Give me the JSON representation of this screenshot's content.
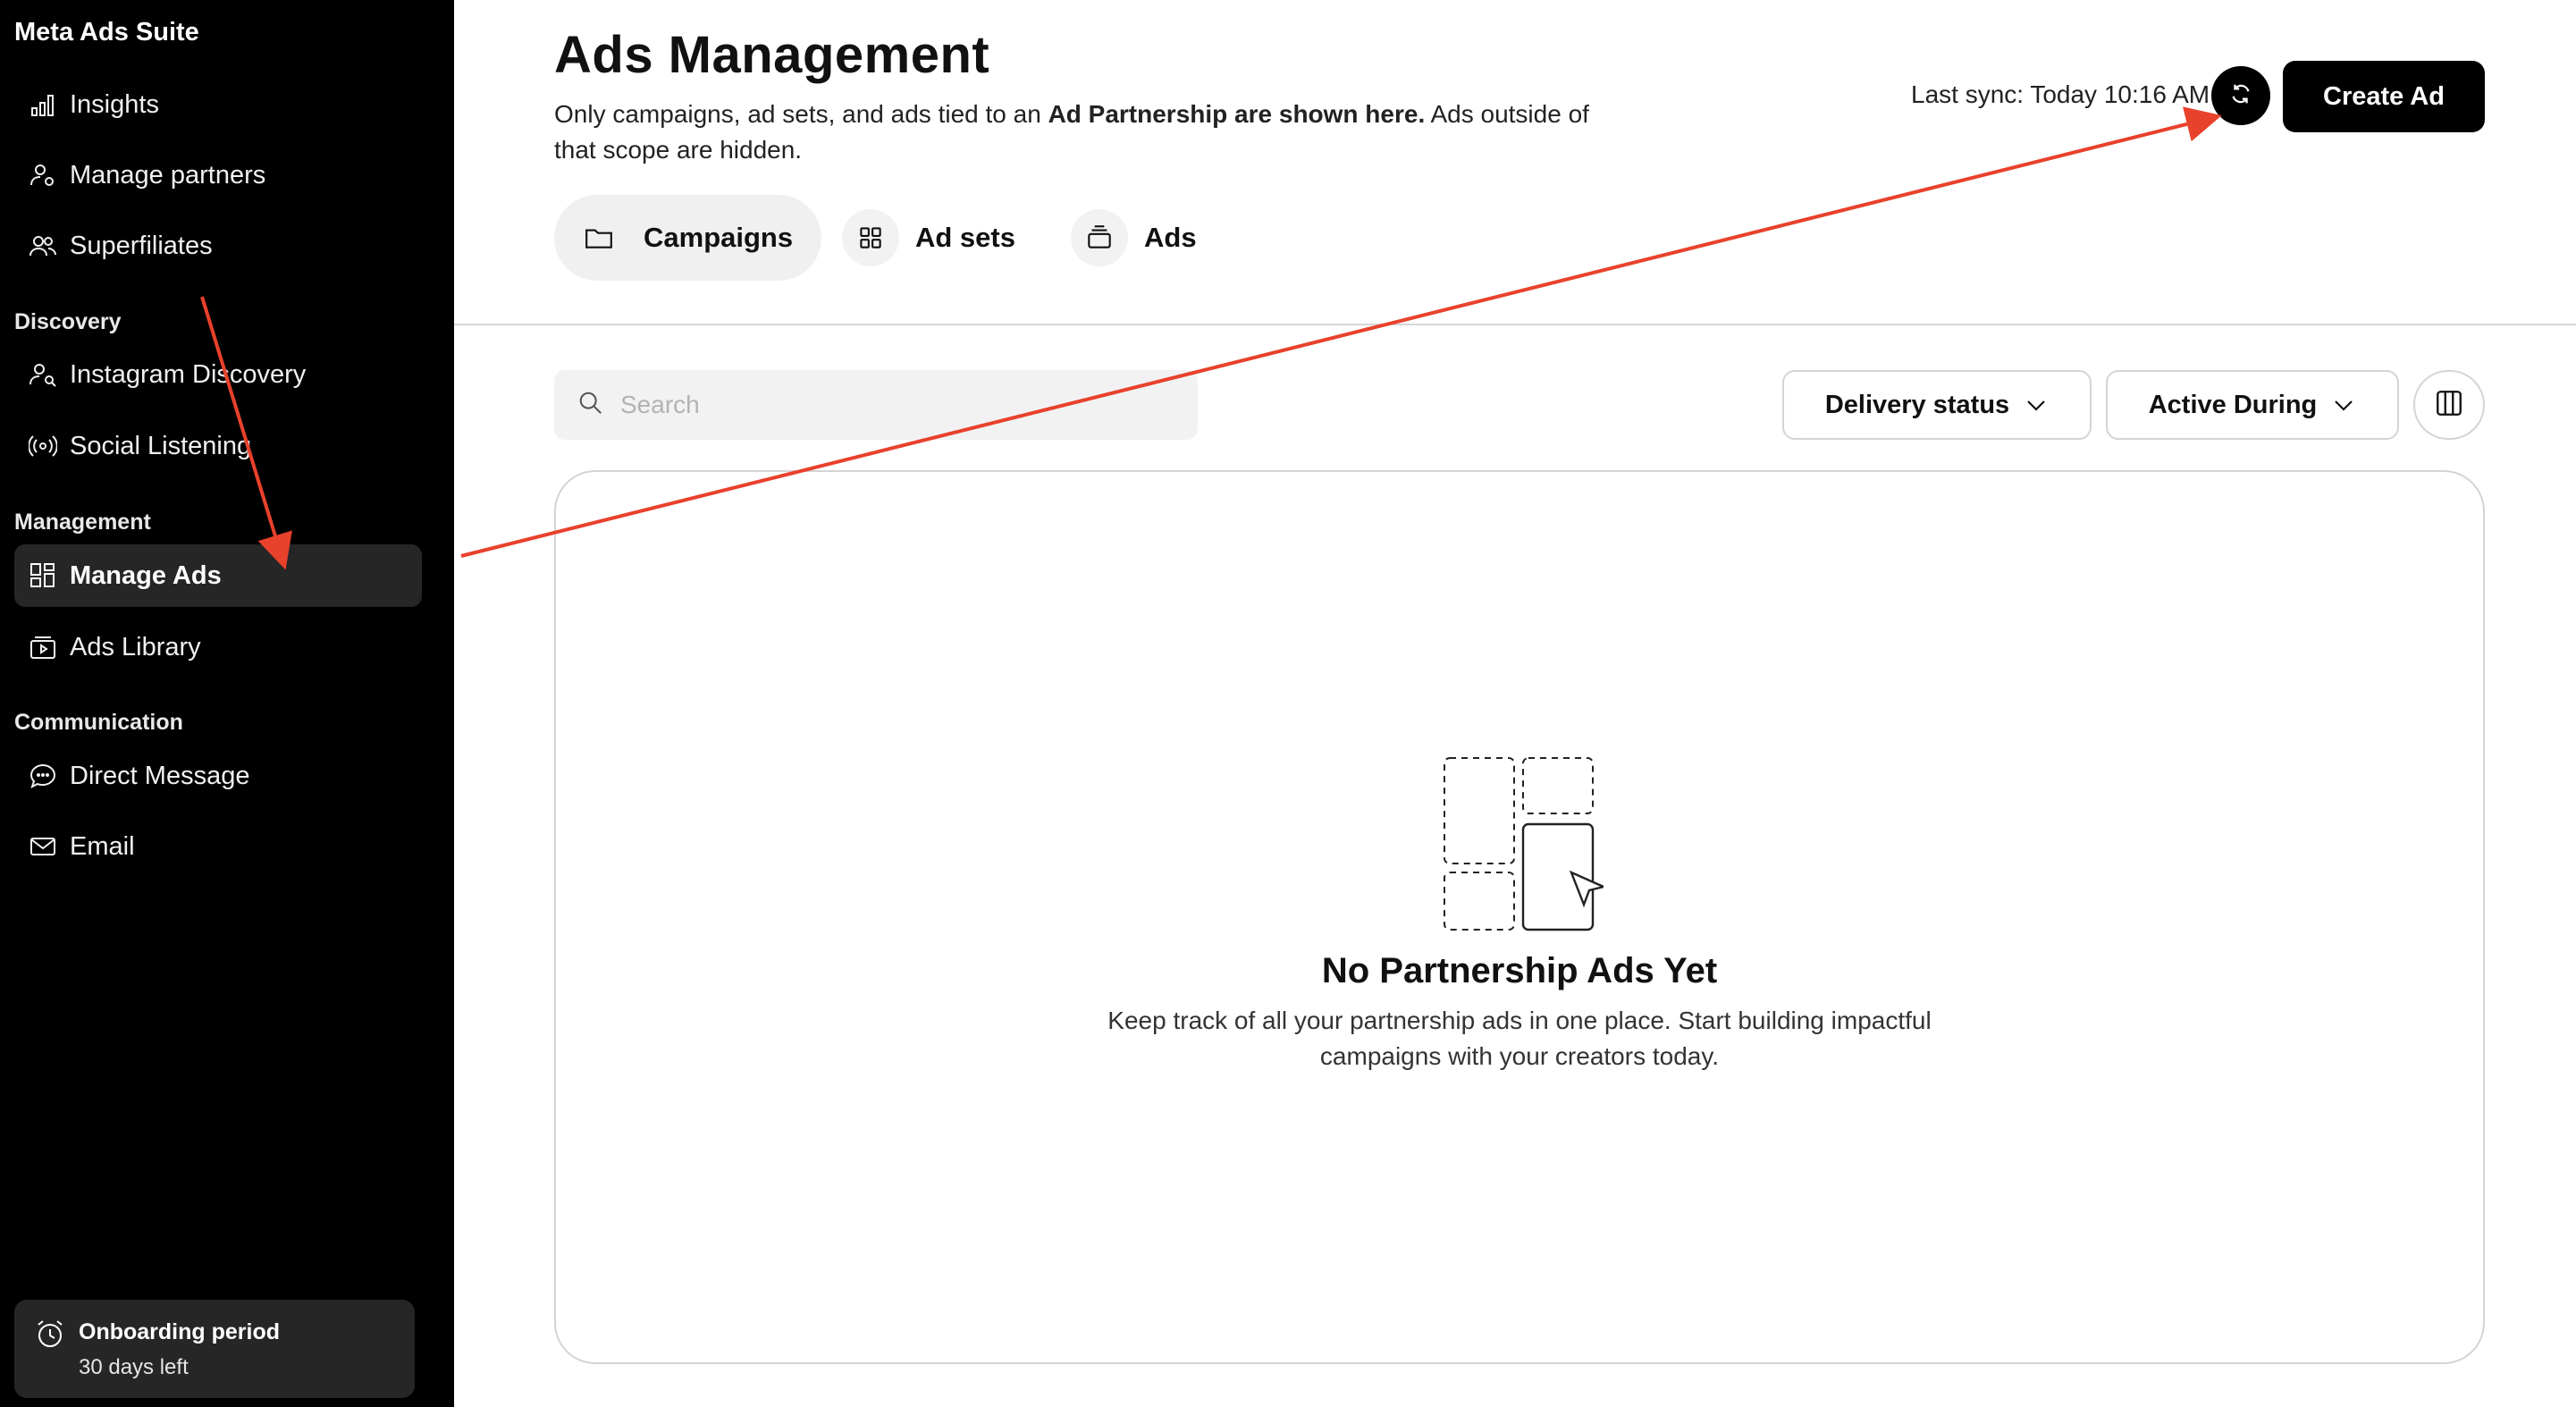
{
  "sidebar": {
    "brand": "Meta Ads Suite",
    "items_top": [
      {
        "label": "Insights",
        "icon": "bar-chart-icon"
      },
      {
        "label": "Manage partners",
        "icon": "user-gear-icon"
      },
      {
        "label": "Superfiliates",
        "icon": "users-icon"
      }
    ],
    "sections": {
      "discovery": "Discovery",
      "management": "Management",
      "communication": "Communication"
    },
    "discovery_items": [
      {
        "label": "Instagram Discovery",
        "icon": "user-search-icon"
      },
      {
        "label": "Social Listening",
        "icon": "broadcast-icon"
      }
    ],
    "management_items": [
      {
        "label": "Manage Ads",
        "icon": "grid-icon",
        "active": true
      },
      {
        "label": "Ads Library",
        "icon": "play-library-icon"
      }
    ],
    "communication_items": [
      {
        "label": "Direct Message",
        "icon": "chat-bubble-icon"
      },
      {
        "label": "Email",
        "icon": "envelope-icon"
      }
    ],
    "onboarding": {
      "title": "Onboarding period",
      "subtitle": "30 days left",
      "icon": "alarm-clock-icon"
    }
  },
  "header": {
    "title": "Ads Management",
    "desc_part1": "Only campaigns, ad sets, and ads tied to an ",
    "desc_bold": "Ad Partnership are shown here.",
    "desc_part2": " Ads outside of that scope are hidden.",
    "sync_label": "Last sync: Today 10:16 AM",
    "create_label": "Create Ad"
  },
  "tabs": [
    {
      "label": "Campaigns",
      "icon": "folder-icon",
      "active": true
    },
    {
      "label": "Ad sets",
      "icon": "grid-icon",
      "active": false
    },
    {
      "label": "Ads",
      "icon": "stack-icon",
      "active": false
    }
  ],
  "toolbar": {
    "search_placeholder": "Search",
    "delivery_status": "Delivery status",
    "active_during": "Active During"
  },
  "empty": {
    "title": "No Partnership Ads Yet",
    "subtitle_line1": "Keep track of all your partnership ads in one place. Start building impactful",
    "subtitle_line2": "campaigns with your creators today."
  },
  "colors": {
    "sidebar_bg": "#000000",
    "active_item_bg": "#262626",
    "accent_annotation": "#e8412c",
    "primary_button": "#000000"
  }
}
